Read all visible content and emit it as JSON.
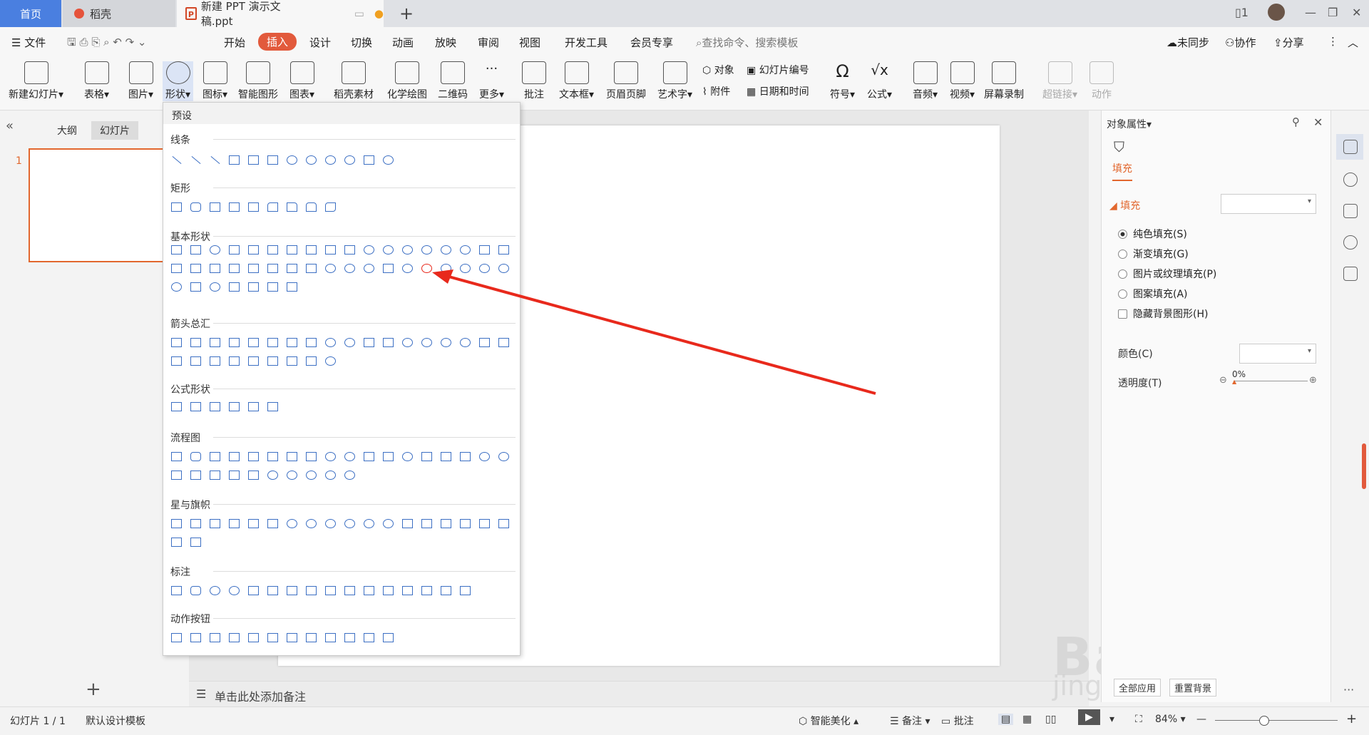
{
  "tabs": {
    "home": "首页",
    "daoke": "稻壳",
    "doc": "新建 PPT 演示文稿.ppt"
  },
  "menu": {
    "file": "文件",
    "items": [
      "开始",
      "插入",
      "设计",
      "切换",
      "动画",
      "放映",
      "审阅",
      "视图",
      "开发工具",
      "会员专享"
    ],
    "search_placeholder": "查找命令、搜索模板",
    "sync": "未同步",
    "collab": "协作",
    "share": "分享"
  },
  "ribbon": {
    "new_slide": "新建幻灯片",
    "table": "表格",
    "picture": "图片",
    "shape": "形状",
    "icon": "图标",
    "smartart": "智能图形",
    "chart": "图表",
    "daoke_material": "稻壳素材",
    "chem": "化学绘图",
    "qrcode": "二维码",
    "more": "更多",
    "comment": "批注",
    "textbox": "文本框",
    "header_footer": "页眉页脚",
    "wordart": "艺术字",
    "object": "对象",
    "attachment": "附件",
    "slide_number": "幻灯片编号",
    "datetime": "日期和时间",
    "symbol": "符号",
    "formula": "公式",
    "audio": "音频",
    "video": "视频",
    "screen_record": "屏幕录制",
    "hyperlink": "超链接",
    "action": "动作"
  },
  "left_panel": {
    "outline": "大纲",
    "slides": "幻灯片",
    "slide_num": "1"
  },
  "shapes_panel": {
    "preset": "预设",
    "sections": [
      "线条",
      "矩形",
      "基本形状",
      "箭头总汇",
      "公式形状",
      "流程图",
      "星与旗帜",
      "标注",
      "动作按钮"
    ]
  },
  "notes": {
    "placeholder": "单击此处添加备注"
  },
  "right_panel": {
    "title": "对象属性",
    "fill_tab": "填充",
    "fill_header": "填充",
    "options": [
      "纯色填充(S)",
      "渐变填充(G)",
      "图片或纹理填充(P)",
      "图案填充(A)"
    ],
    "hide_bg": "隐藏背景图形(H)",
    "color": "颜色(C)",
    "transparency": "透明度(T)",
    "transparency_value": "0%",
    "apply_all": "全部应用",
    "reset_bg": "重置背景"
  },
  "status": {
    "slide_info": "幻灯片 1 / 1",
    "template": "默认设计模板",
    "beautify": "智能美化",
    "notes": "备注",
    "comment": "批注",
    "zoom": "84%"
  },
  "watermark": {
    "brand": "Baidu经验",
    "url": "jingyan.baidu.com"
  },
  "colors": {
    "accent": "#e25a3c",
    "home_tab": "#4a7fe0",
    "shape_stroke": "#3c6fc3",
    "arrow": "#e8291c"
  }
}
